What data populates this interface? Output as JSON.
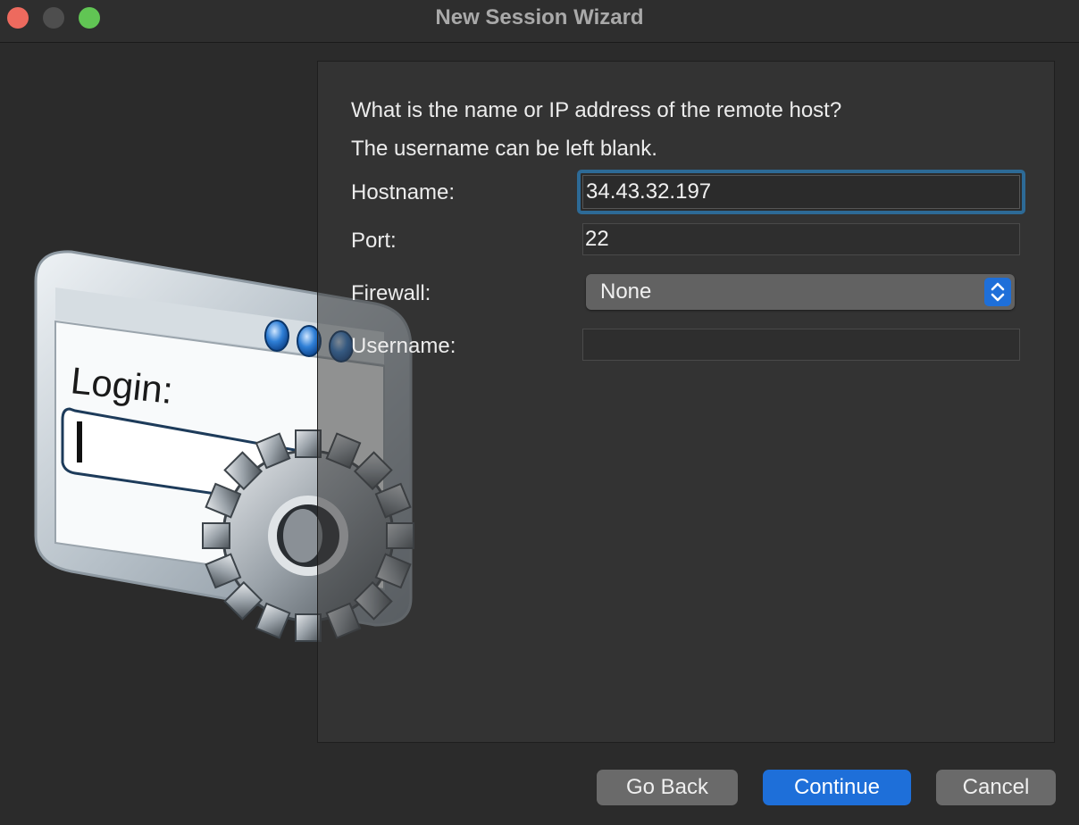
{
  "window": {
    "title": "New Session Wizard"
  },
  "wizard": {
    "prompt_line1": "What is the name or IP address of the remote host?",
    "prompt_line2": "The username can be left blank.",
    "illustration": {
      "icon": "login-window-gear-icon",
      "login_text": "Login:"
    }
  },
  "form": {
    "hostname_label": "Hostname:",
    "hostname_value": "34.43.32.197",
    "port_label": "Port:",
    "port_value": "22",
    "firewall_label": "Firewall:",
    "firewall_selected": "None",
    "username_label": "Username:",
    "username_value": ""
  },
  "buttons": {
    "back": "Go Back",
    "continue": "Continue",
    "cancel": "Cancel"
  },
  "colors": {
    "accent": "#1e6fd9",
    "focus_ring": "#2d6a96",
    "close": "#ed6a5e",
    "maximize": "#61c554"
  }
}
